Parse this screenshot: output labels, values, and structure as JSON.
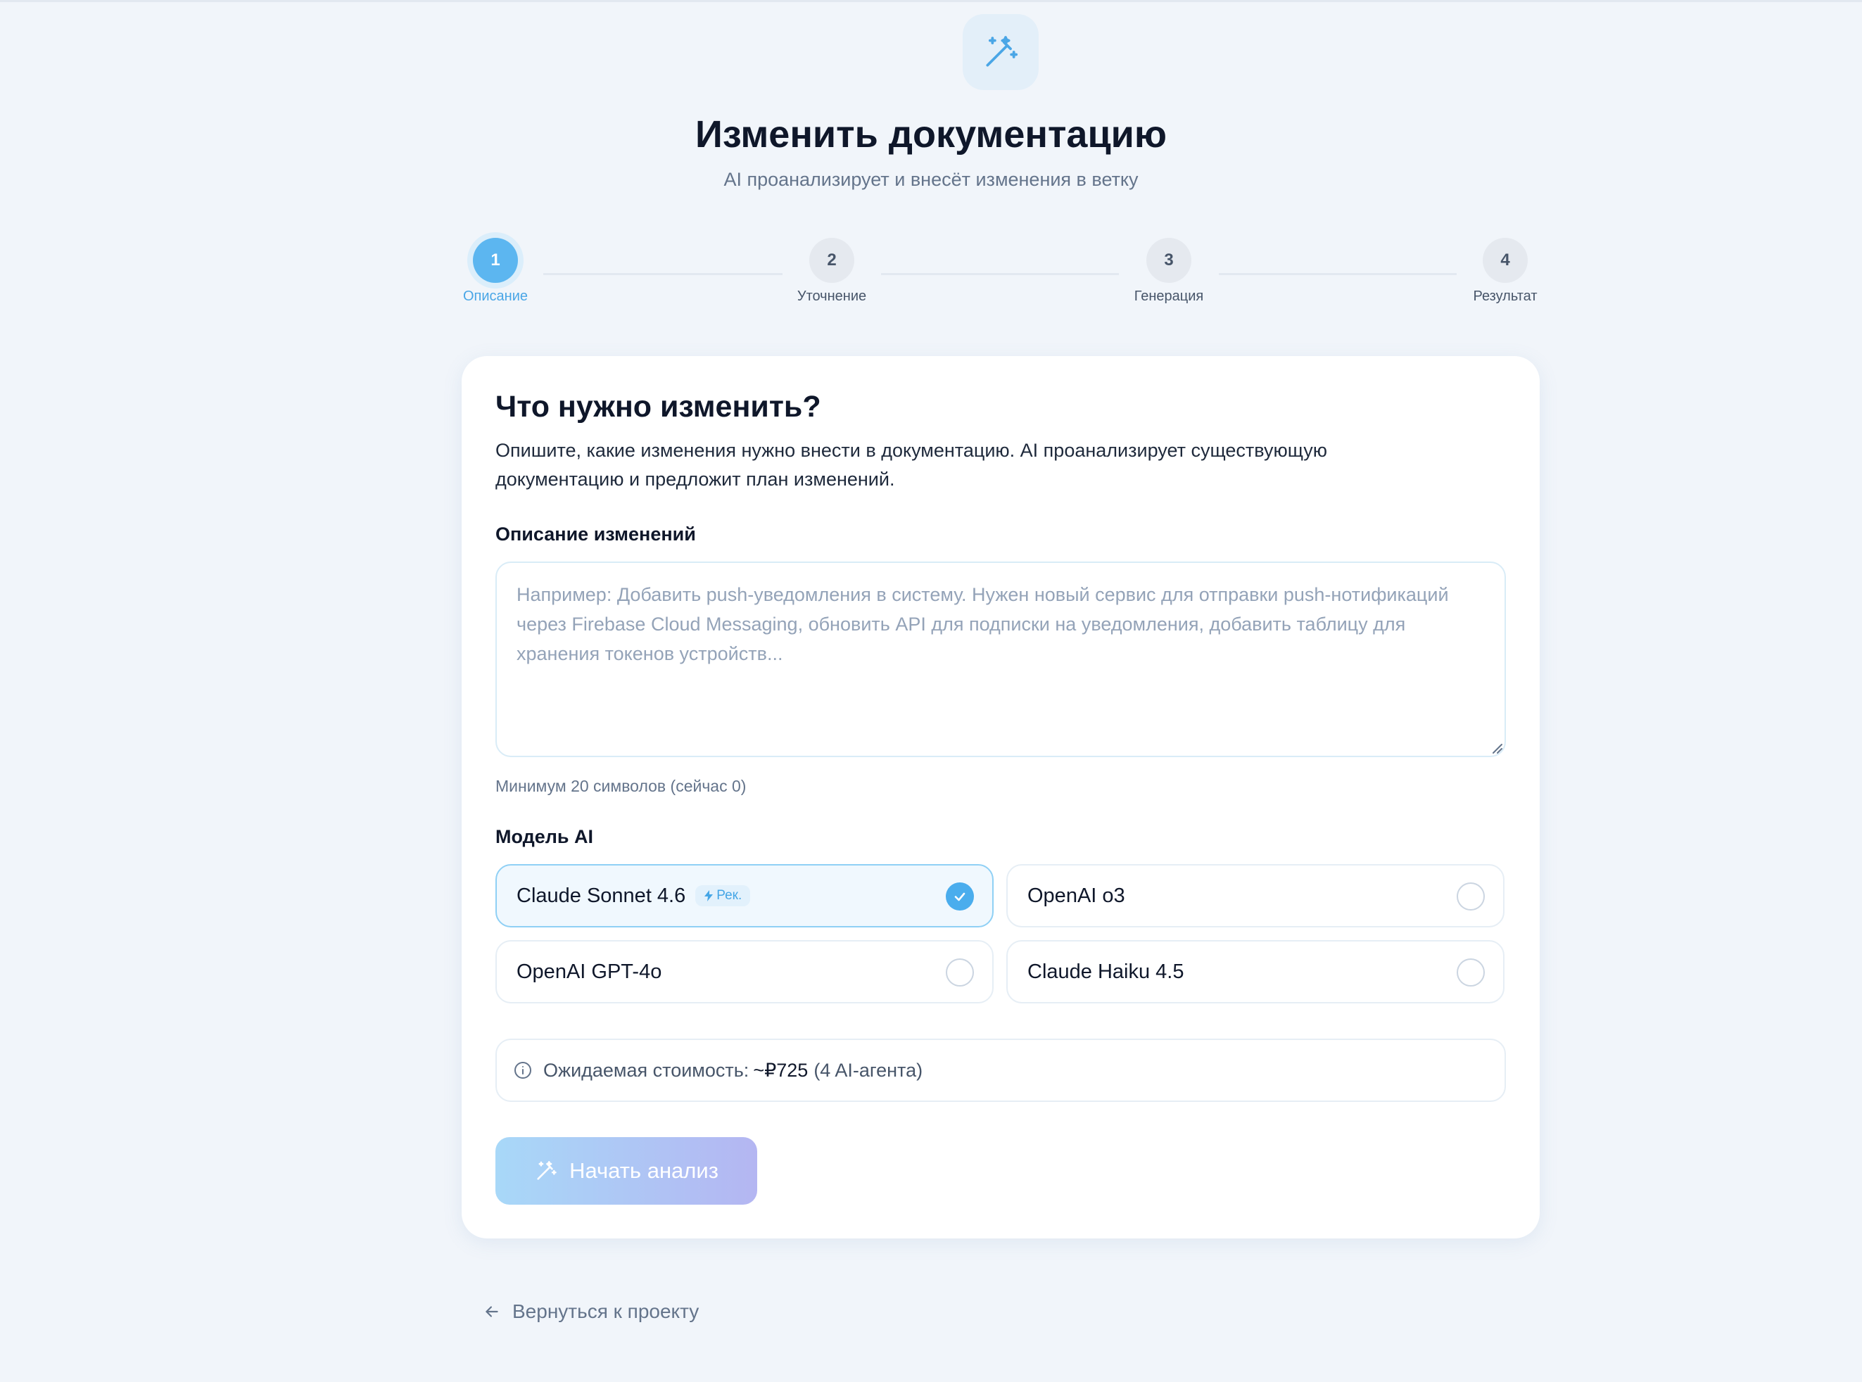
{
  "header": {
    "icon": "magic-wand-icon",
    "title": "Изменить документацию",
    "subtitle": "AI проанализирует и внесёт изменения в ветку"
  },
  "stepper": {
    "current_step": 1,
    "steps": [
      {
        "number": "1",
        "label": "Описание"
      },
      {
        "number": "2",
        "label": "Уточнение"
      },
      {
        "number": "3",
        "label": "Генерация"
      },
      {
        "number": "4",
        "label": "Результат"
      }
    ]
  },
  "form": {
    "title": "Что нужно изменить?",
    "description": "Опишите, какие изменения нужно внести в документацию. AI проанализирует существующую документацию и предложит план изменений.",
    "changes_label": "Описание изменений",
    "changes_value": "",
    "changes_placeholder": "Например: Добавить push-уведомления в систему. Нужен новый сервис для отправки push-нотификаций через Firebase Cloud Messaging, обновить API для подписки на уведомления, добавить таблицу для хранения токенов устройств...",
    "min_chars_hint": "Минимум 20 символов (сейчас 0)",
    "model_label": "Модель AI",
    "models": [
      {
        "name": "Claude Sonnet 4.6",
        "badge": "Рек.",
        "selected": true
      },
      {
        "name": "OpenAI o3",
        "selected": false
      },
      {
        "name": "OpenAI GPT-4o",
        "selected": false
      },
      {
        "name": "Claude Haiku 4.5",
        "selected": false
      }
    ],
    "cost": {
      "label": "Ожидаемая стоимость:",
      "value": "~₽725",
      "note": "(4 AI-агента)"
    },
    "start_button_label": "Начать анализ"
  },
  "footer": {
    "back_link_label": "Вернуться к проекту"
  },
  "colors": {
    "accent": "#5cb6f0",
    "page_background": "#f1f5fa",
    "button_gradient_start": "#a8d8f8",
    "button_gradient_end": "#b4b6f2"
  }
}
